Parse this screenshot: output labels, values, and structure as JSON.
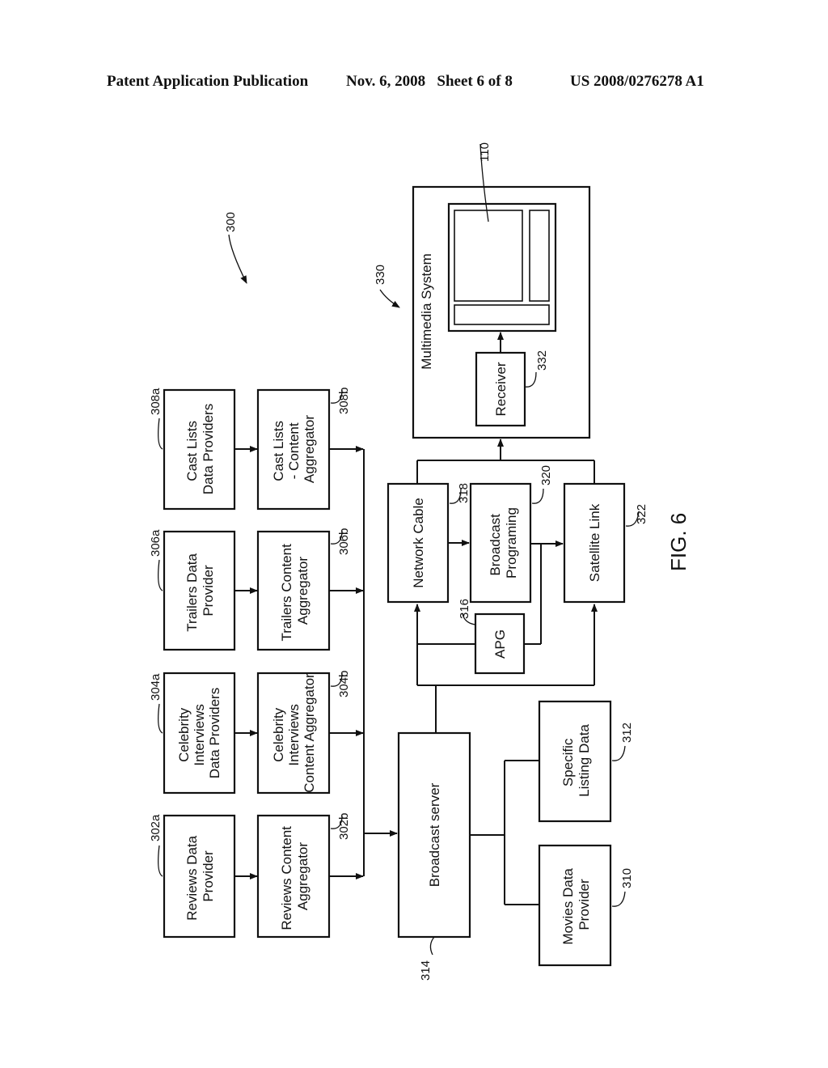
{
  "header": {
    "publication": "Patent Application Publication",
    "date_sheet": "Nov. 6, 2008   Sheet 6 of 8",
    "number": "US 2008/0276278 A1"
  },
  "figure": {
    "label": "FIG. 6",
    "system_ref": "300",
    "providers": [
      {
        "ref": "302a",
        "lines": [
          "Reviews Data",
          "Provider"
        ]
      },
      {
        "ref": "304a",
        "lines": [
          "Celebrity",
          "Interviews",
          "Data Providers"
        ]
      },
      {
        "ref": "306a",
        "lines": [
          "Trailers Data",
          "Provider"
        ]
      },
      {
        "ref": "308a",
        "lines": [
          "Cast Lists",
          "Data Providers"
        ]
      }
    ],
    "aggregators": [
      {
        "ref": "302b",
        "lines": [
          "Reviews Content",
          "Aggregator"
        ]
      },
      {
        "ref": "304b",
        "lines": [
          "Celebrity",
          "Interviews",
          "Content Aggregator"
        ]
      },
      {
        "ref": "306b",
        "lines": [
          "Trailers Content",
          "Aggregator"
        ]
      },
      {
        "ref": "308b",
        "lines": [
          "Cast Lists",
          "- Content",
          "Aggregator"
        ]
      }
    ],
    "broadcast_server": {
      "ref": "314",
      "lines": [
        "Broadcast server"
      ]
    },
    "movies_data_provider": {
      "ref": "310",
      "lines": [
        "Movies Data",
        "Provider"
      ]
    },
    "specific_listing_data": {
      "ref": "312",
      "lines": [
        "Specific",
        "Listing Data"
      ]
    },
    "apg": {
      "ref": "316",
      "lines": [
        "APG"
      ]
    },
    "network_cable": {
      "ref": "318",
      "lines": [
        "Network Cable"
      ]
    },
    "broadcast_programing": {
      "ref": "320",
      "lines": [
        "Broadcast",
        "Programing"
      ]
    },
    "satellite_link": {
      "ref": "322",
      "lines": [
        "Satellite Link"
      ]
    },
    "multimedia_system": {
      "ref": "330",
      "lines": [
        "Multimedia System"
      ]
    },
    "receiver": {
      "ref": "332",
      "lines": [
        "Receiver"
      ]
    },
    "display": {
      "ref": "110"
    }
  }
}
